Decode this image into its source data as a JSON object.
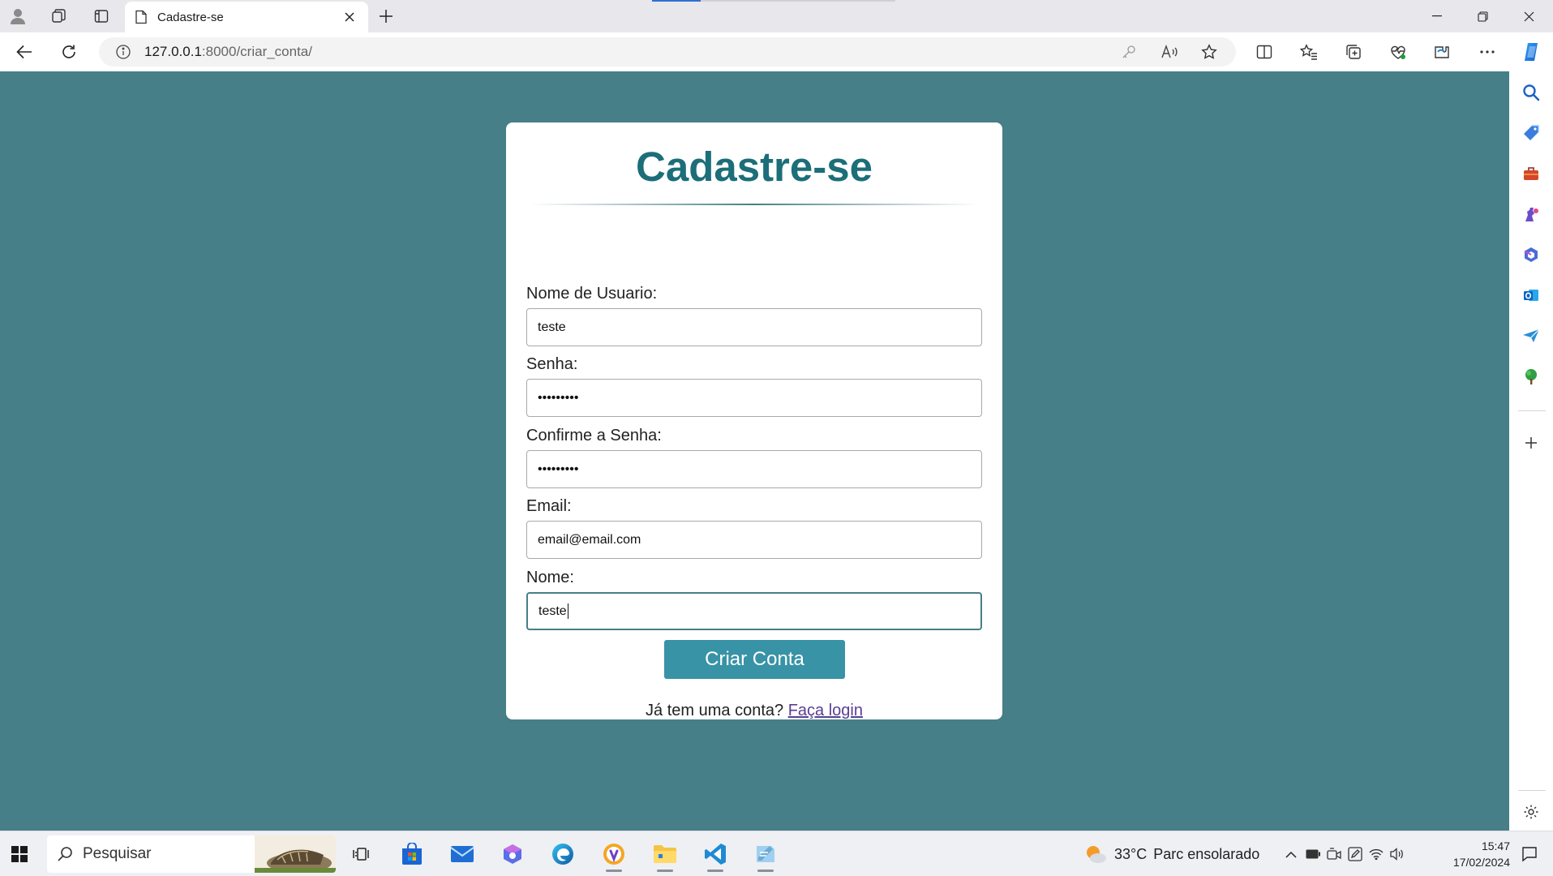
{
  "browser": {
    "tab_title": "Cadastre-se",
    "url_host": "127.0.0.1",
    "url_path": ":8000/criar_conta/"
  },
  "page": {
    "title": "Cadastre-se",
    "fields": [
      {
        "label": "Nome de Usuario:",
        "value": "teste"
      },
      {
        "label": "Senha:",
        "value": "•••••••••"
      },
      {
        "label": "Confirme a Senha:",
        "value": "•••••••••"
      },
      {
        "label": "Email:",
        "value": "email@email.com"
      },
      {
        "label": "Nome:",
        "value": "teste"
      }
    ],
    "submit_label": "Criar Conta",
    "login_prompt": "Já tem uma conta?",
    "login_link": "Faça login"
  },
  "colors": {
    "page_background": "#467f87",
    "title": "#1c6e79",
    "button": "#3893a6",
    "link": "#5a3e93"
  },
  "taskbar": {
    "search_placeholder": "Pesquisar",
    "weather_temp": "33°C",
    "weather_desc": "Parc ensolarado",
    "time": "15:47",
    "date": "17/02/2024"
  },
  "icons": {
    "tabstrip": [
      "profile-icon",
      "workspaces-icon",
      "vertical-tabs-icon",
      "page-icon",
      "close-icon",
      "new-tab-icon",
      "minimize-icon",
      "restore-icon",
      "close-window-icon"
    ],
    "toolbar": [
      "back-icon",
      "refresh-icon",
      "info-icon",
      "key-icon",
      "read-aloud-icon",
      "favorite-star-icon",
      "split-screen-icon",
      "favorites-icon",
      "collections-icon",
      "browser-essentials-icon",
      "extensions-icon",
      "more-icon",
      "copilot-icon"
    ],
    "sidebar": [
      "search-icon",
      "shopping-tag-icon",
      "tools-icon",
      "games-icon",
      "microsoft-365-icon",
      "outlook-icon",
      "send-icon",
      "tree-icon",
      "add-icon",
      "settings-icon"
    ]
  }
}
